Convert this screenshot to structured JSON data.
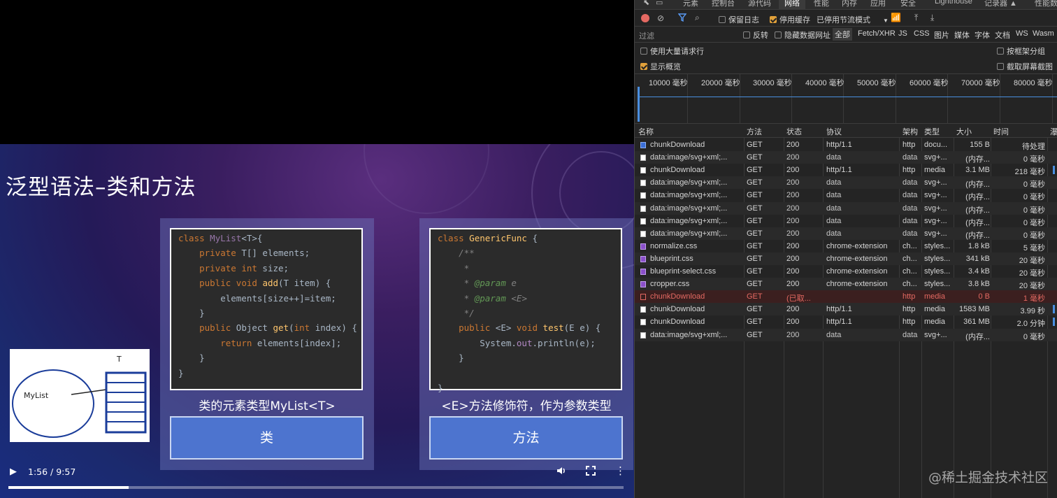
{
  "slide": {
    "title": "泛型语法–类和方法",
    "left": {
      "caption": "类的元素类型MyList<T>",
      "button": "类"
    },
    "right": {
      "caption": "<E>方法修饰符，作为参数类型",
      "button": "方法"
    },
    "sketch": {
      "circle_label": "MyList",
      "array_label": "T"
    }
  },
  "player": {
    "time": "1:56 / 9:57",
    "progress": 0.195
  },
  "devtools": {
    "tabs": [
      "元素",
      "控制台",
      "源代码",
      "网络",
      "性能",
      "内存",
      "应用",
      "安全",
      "Lighthouse",
      "记录器 ▲",
      "性能数据"
    ],
    "active_tab": "网络",
    "toolbar": {
      "preserve_log": "保留日志",
      "disable_cache": "停用缓存",
      "throttle": "已停用节流模式"
    },
    "filter": {
      "placeholder": "过滤",
      "invert": "反转",
      "hide_data_urls": "隐藏数据网址",
      "types": [
        "全部",
        "Fetch/XHR",
        "JS",
        "CSS",
        "图片",
        "媒体",
        "字体",
        "文档",
        "WS",
        "Wasm"
      ]
    },
    "options": {
      "big_rows": "使用大量请求行",
      "group_by_frame": "按框架分组",
      "show_overview": "显示概览",
      "capture_screenshots": "截取屏幕截图"
    },
    "timeline_ticks": [
      "10000 毫秒",
      "20000 毫秒",
      "30000 毫秒",
      "40000 毫秒",
      "50000 毫秒",
      "60000 毫秒",
      "70000 毫秒",
      "80000 毫秒"
    ],
    "columns": [
      "名称",
      "方法",
      "状态",
      "协议",
      "架构",
      "类型",
      "大小",
      "时间",
      "瀑"
    ],
    "rows": [
      [
        "chunkDownload",
        "GET",
        "200",
        "http/1.1",
        "http",
        "docu...",
        "155 B",
        "待处理"
      ],
      [
        "data:image/svg+xml;...",
        "GET",
        "200",
        "data",
        "data",
        "svg+...",
        "(内存...",
        "0 毫秒"
      ],
      [
        "chunkDownload",
        "GET",
        "200",
        "http/1.1",
        "http",
        "media",
        "3.1 MB",
        "218 毫秒"
      ],
      [
        "data:image/svg+xml;...",
        "GET",
        "200",
        "data",
        "data",
        "svg+...",
        "(内存...",
        "0 毫秒"
      ],
      [
        "data:image/svg+xml;...",
        "GET",
        "200",
        "data",
        "data",
        "svg+...",
        "(内存...",
        "0 毫秒"
      ],
      [
        "data:image/svg+xml;...",
        "GET",
        "200",
        "data",
        "data",
        "svg+...",
        "(内存...",
        "0 毫秒"
      ],
      [
        "data:image/svg+xml;...",
        "GET",
        "200",
        "data",
        "data",
        "svg+...",
        "(内存...",
        "0 毫秒"
      ],
      [
        "data:image/svg+xml;...",
        "GET",
        "200",
        "data",
        "data",
        "svg+...",
        "(内存...",
        "0 毫秒"
      ],
      [
        "normalize.css",
        "GET",
        "200",
        "chrome-extension",
        "ch...",
        "styles...",
        "1.8 kB",
        "5 毫秒"
      ],
      [
        "blueprint.css",
        "GET",
        "200",
        "chrome-extension",
        "ch...",
        "styles...",
        "341 kB",
        "20 毫秒"
      ],
      [
        "blueprint-select.css",
        "GET",
        "200",
        "chrome-extension",
        "ch...",
        "styles...",
        "3.4 kB",
        "20 毫秒"
      ],
      [
        "cropper.css",
        "GET",
        "200",
        "chrome-extension",
        "ch...",
        "styles...",
        "3.8 kB",
        "20 毫秒"
      ],
      [
        "chunkDownload",
        "GET",
        "(已取...",
        "",
        "http",
        "media",
        "0 B",
        "1 毫秒"
      ],
      [
        "chunkDownload",
        "GET",
        "200",
        "http/1.1",
        "http",
        "media",
        "1583 MB",
        "3.99 秒"
      ],
      [
        "chunkDownload",
        "GET",
        "200",
        "http/1.1",
        "http",
        "media",
        "361 MB",
        "2.0 分钟"
      ],
      [
        "data:image/svg+xml;...",
        "GET",
        "200",
        "data",
        "data",
        "svg+...",
        "(内存...",
        "0 毫秒"
      ]
    ]
  },
  "watermark": "@稀土掘金技术社区"
}
